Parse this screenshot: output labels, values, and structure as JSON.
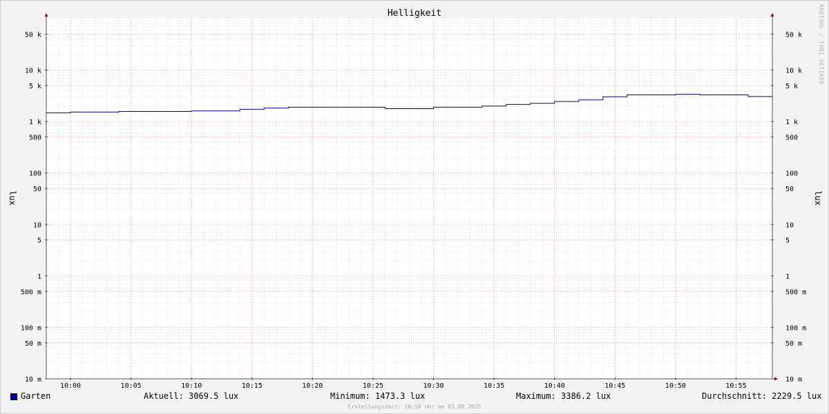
{
  "chart_data": {
    "type": "line",
    "title": "Helligkeit",
    "ylabel": "lux",
    "y_scale": "log",
    "ylim": [
      0.01,
      100000
    ],
    "y_ticks": [
      {
        "value": 50000,
        "label": "50 k"
      },
      {
        "value": 10000,
        "label": "10 k"
      },
      {
        "value": 5000,
        "label": "5 k"
      },
      {
        "value": 1000,
        "label": "1 k"
      },
      {
        "value": 500,
        "label": "500"
      },
      {
        "value": 100,
        "label": "100"
      },
      {
        "value": 50,
        "label": "50"
      },
      {
        "value": 10,
        "label": "10"
      },
      {
        "value": 5,
        "label": "5"
      },
      {
        "value": 1,
        "label": "1"
      },
      {
        "value": 0.5,
        "label": "500 m"
      },
      {
        "value": 0.1,
        "label": "100 m"
      },
      {
        "value": 0.05,
        "label": "50 m"
      },
      {
        "value": 0.01,
        "label": "10 m"
      }
    ],
    "x_range": [
      "09:58",
      "10:58"
    ],
    "x_ticks": [
      "10:00",
      "10:05",
      "10:10",
      "10:15",
      "10:20",
      "10:25",
      "10:30",
      "10:35",
      "10:40",
      "10:45",
      "10:50",
      "10:55"
    ],
    "grid": true,
    "legend_position": "bottom-left",
    "series": [
      {
        "name": "Garten",
        "color": "#000080",
        "points": [
          {
            "t": "09:58",
            "v": 1473.3
          },
          {
            "t": "10:00",
            "v": 1530
          },
          {
            "t": "10:04",
            "v": 1570
          },
          {
            "t": "10:10",
            "v": 1610
          },
          {
            "t": "10:14",
            "v": 1730
          },
          {
            "t": "10:16",
            "v": 1830
          },
          {
            "t": "10:18",
            "v": 1900
          },
          {
            "t": "10:26",
            "v": 1780
          },
          {
            "t": "10:30",
            "v": 1900
          },
          {
            "t": "10:34",
            "v": 2000
          },
          {
            "t": "10:36",
            "v": 2150
          },
          {
            "t": "10:38",
            "v": 2260
          },
          {
            "t": "10:40",
            "v": 2450
          },
          {
            "t": "10:42",
            "v": 2640
          },
          {
            "t": "10:44",
            "v": 3030
          },
          {
            "t": "10:46",
            "v": 3300
          },
          {
            "t": "10:50",
            "v": 3386.2
          },
          {
            "t": "10:52",
            "v": 3300
          },
          {
            "t": "10:56",
            "v": 3069.5
          },
          {
            "t": "10:58",
            "v": 3069.5
          }
        ]
      }
    ]
  },
  "legend": {
    "series_name": "Garten",
    "swatch_color": "#0000a0",
    "current": "Aktuell: 3069.5 lux",
    "minimum": "Minimum: 1473.3 lux",
    "maximum": "Maximum: 3386.2 lux",
    "average": "Durchschnitt: 2229.5 lux"
  },
  "footer": "Erstellungszeit: 10:58 Uhr am 03.08.2025",
  "credit": "RRDTOOL / TOBI OETIKER"
}
